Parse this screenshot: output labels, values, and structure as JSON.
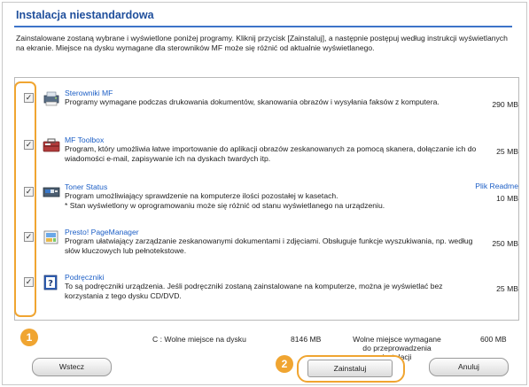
{
  "header": {
    "title": "Instalacja niestandardowa",
    "description": "Zainstalowane zostaną wybrane i wyświetlone poniżej programy. Kliknij przycisk [Zainstaluj], a następnie postępuj według instrukcji wyświetlanych na ekranie. Miejsce na dysku wymagane dla sterowników MF może się różnić od aktualnie wyświetlanego."
  },
  "programs": [
    {
      "name": "Sterowniki MF",
      "description": "Programy wymagane podczas drukowania dokumentów, skanowania obrazów i wysyłania faksów z komputera.",
      "size": "290 MB",
      "checked": true,
      "icon": "printer-icon"
    },
    {
      "name": "MF Toolbox",
      "description": "Program, który umożliwia łatwe importowanie do aplikacji obrazów zeskanowanych za pomocą skanera, dołączanie ich do wiadomości e-mail, zapisywanie ich na dyskach twardych itp.",
      "size": "25 MB",
      "checked": true,
      "icon": "toolbox-icon"
    },
    {
      "name": "Toner Status",
      "description": "Program umożliwiający sprawdzenie na komputerze ilości pozostałej w kasetach.\n* Stan wyświetlony w oprogramowaniu może się różnić od stanu wyświetlanego na urządzeniu.",
      "size": "10 MB",
      "checked": true,
      "icon": "toner-icon",
      "link": "Plik Readme"
    },
    {
      "name": "Presto! PageManager",
      "description": "Program ułatwiający zarządzanie zeskanowanymi dokumentami i zdjęciami. Obsługuje funkcje wyszukiwania, np. według słów kluczowych lub pełnotekstowe.",
      "size": "250 MB",
      "checked": true,
      "icon": "pagemanager-icon"
    },
    {
      "name": "Podręczniki",
      "description": "To są podręczniki urządzenia. Jeśli podręczniki zostaną zainstalowane na komputerze, można je wyświetlać bez korzystania z tego dysku CD/DVD.",
      "size": "25 MB",
      "checked": true,
      "icon": "manual-icon"
    }
  ],
  "disk": {
    "free_label": "C : Wolne miejsce na dysku",
    "free_value": "8146 MB",
    "required_label": "Wolne miejsce wymagane do przeprowadzenia instalacji",
    "required_value": "600 MB"
  },
  "buttons": {
    "back": "Wstecz",
    "install": "Zainstaluj",
    "cancel": "Anuluj"
  },
  "badges": {
    "one": "1",
    "two": "2"
  },
  "colors": {
    "title": "#1f4f9c",
    "link": "#1d5fc6",
    "highlight": "#f0a531"
  }
}
